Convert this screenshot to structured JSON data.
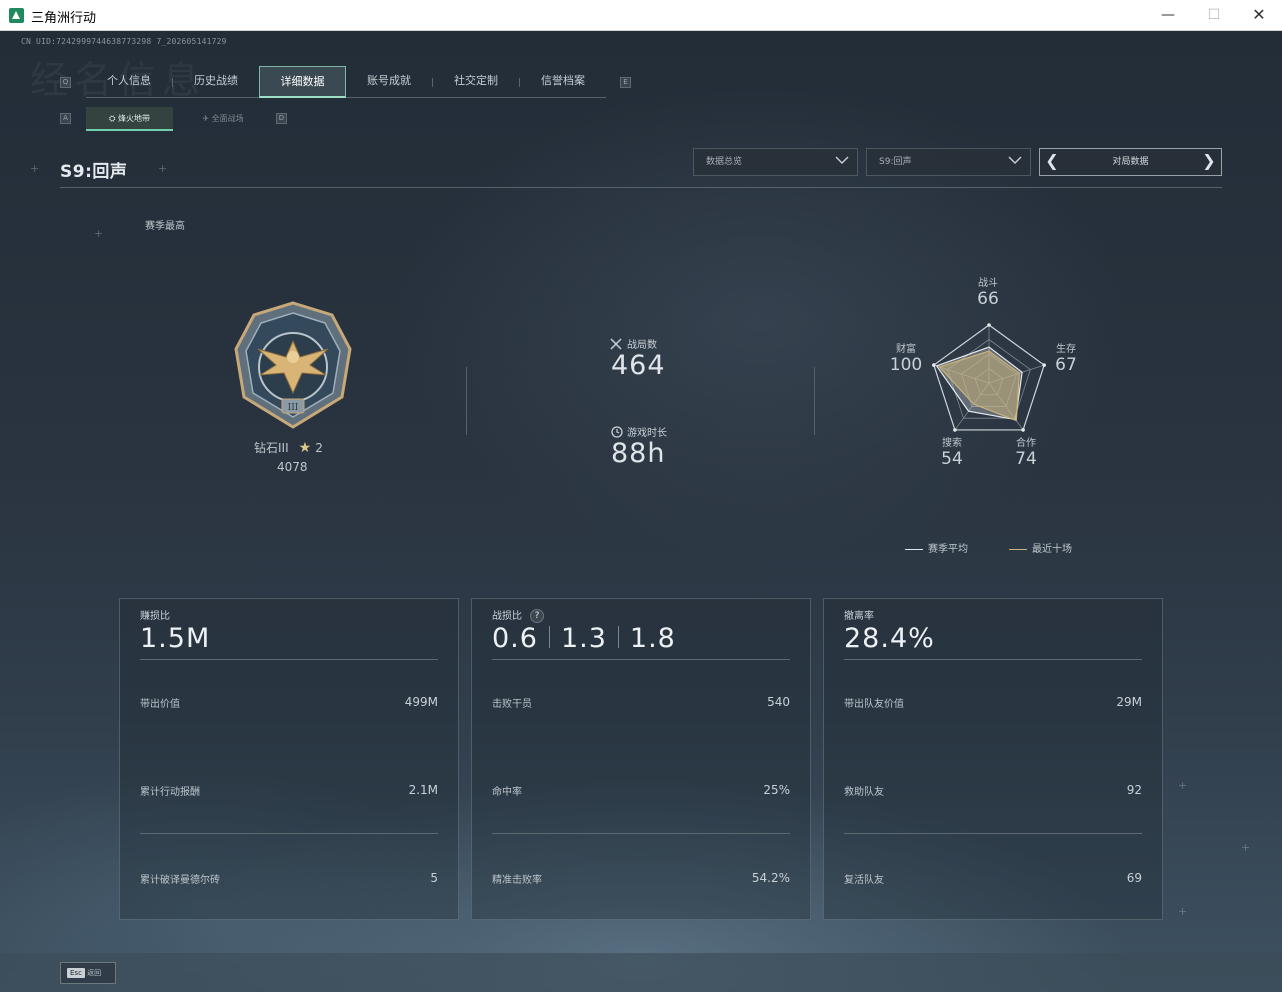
{
  "window": {
    "title": "三角洲行动",
    "minimize_glyph": "—",
    "maximize_glyph": "☐",
    "close_glyph": "✕"
  },
  "uid": "CN UID:7242999744638773298 7_202605141729",
  "background_text": "经名信息",
  "tabs": {
    "left_key": "Q",
    "right_key": "E",
    "items": [
      {
        "label": "个人信息",
        "active": false
      },
      {
        "label": "历史战绩",
        "active": false
      },
      {
        "label": "详细数据",
        "active": true
      },
      {
        "label": "账号成就",
        "active": false
      },
      {
        "label": "社交定制",
        "active": false
      },
      {
        "label": "信誉档案",
        "active": false
      }
    ]
  },
  "subtabs": {
    "left_key": "A",
    "right_key": "D",
    "items": [
      {
        "label": "烽火地带",
        "icon": "flame-zone-icon",
        "active": true
      },
      {
        "label": "全面战场",
        "icon": "battlefield-icon",
        "active": false
      }
    ]
  },
  "season": {
    "title": "S9:回声",
    "best_label": "赛季最高"
  },
  "filters": {
    "data_overview": "数据总览",
    "season_select": "S9:回声",
    "pager_label": "对局数据",
    "prev_glyph": "❮",
    "next_glyph": "❯"
  },
  "rank": {
    "name": "钻石III",
    "star_glyph": "★",
    "stars": "2",
    "score": "4078"
  },
  "summary": {
    "matches_label": "战局数",
    "matches_value": "464",
    "playtime_label": "游戏时长",
    "playtime_value": "88h"
  },
  "radar": {
    "axes": [
      {
        "label": "战斗",
        "value": "66"
      },
      {
        "label": "生存",
        "value": "67"
      },
      {
        "label": "合作",
        "value": "74"
      },
      {
        "label": "搜索",
        "value": "54"
      },
      {
        "label": "财富",
        "value": "100"
      }
    ],
    "season_avg": [
      0.62,
      0.6,
      0.78,
      0.6,
      0.95
    ],
    "recent_ten": [
      0.55,
      0.55,
      0.8,
      0.45,
      0.9
    ],
    "legend": [
      {
        "label": "赛季平均",
        "color": "#e6e9ec"
      },
      {
        "label": "最近十场",
        "color": "#c9b37a"
      }
    ]
  },
  "cards": [
    {
      "label": "赚损比",
      "value": "1.5M",
      "rows": [
        {
          "label": "带出价值",
          "value": "499M"
        },
        {
          "label": "累计行动报酬",
          "value": "2.1M"
        },
        {
          "label": "累计破译曼德尔砖",
          "value": "5"
        }
      ]
    },
    {
      "label": "战损比",
      "help_glyph": "?",
      "values": [
        "0.6",
        "1.3",
        "1.8"
      ],
      "rows": [
        {
          "label": "击败干员",
          "value": "540"
        },
        {
          "label": "命中率",
          "value": "25%"
        },
        {
          "label": "精准击败率",
          "value": "54.2%"
        }
      ]
    },
    {
      "label": "撤离率",
      "value": "28.4%",
      "rows": [
        {
          "label": "带出队友价值",
          "value": "29M"
        },
        {
          "label": "救助队友",
          "value": "92"
        },
        {
          "label": "复活队友",
          "value": "69"
        }
      ]
    }
  ],
  "footer": {
    "esc_key": "Esc",
    "esc_label": "返回"
  },
  "colors": {
    "accent": "#9ee0c6",
    "radar_recent": "#c9b37a"
  }
}
